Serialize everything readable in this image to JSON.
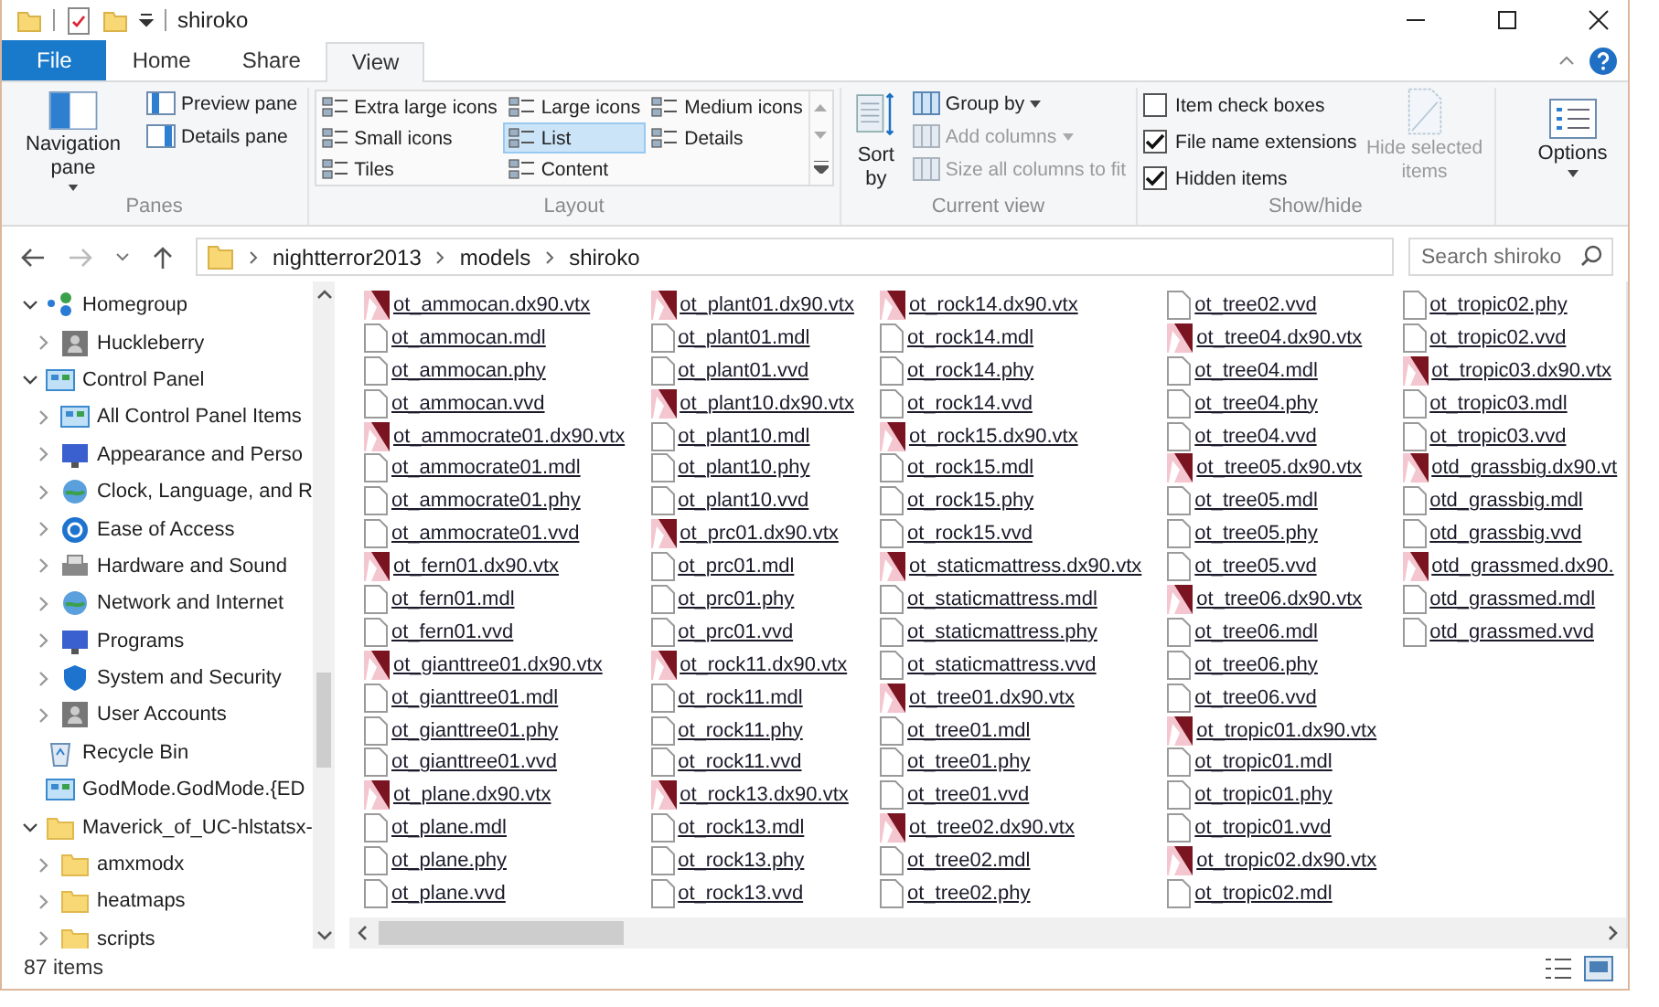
{
  "title_bar": {
    "title": "shiroko"
  },
  "ribbon": {
    "tabs": [
      {
        "label": "File",
        "kind": "file",
        "selected": false
      },
      {
        "label": "Home",
        "kind": "tab",
        "selected": false
      },
      {
        "label": "Share",
        "kind": "tab",
        "selected": false
      },
      {
        "label": "View",
        "kind": "tab",
        "selected": true
      }
    ],
    "panes": {
      "label": "Panes",
      "navigation_button": "Navigation pane",
      "buttons": [
        "Preview pane",
        "Details pane"
      ]
    },
    "layout": {
      "label": "Layout",
      "options": [
        {
          "label": "Extra large icons",
          "selected": false
        },
        {
          "label": "Large icons",
          "selected": false
        },
        {
          "label": "Medium icons",
          "selected": false
        },
        {
          "label": "Small icons",
          "selected": false
        },
        {
          "label": "List",
          "selected": true
        },
        {
          "label": "Details",
          "selected": false
        },
        {
          "label": "Tiles",
          "selected": false
        },
        {
          "label": "Content",
          "selected": false
        }
      ]
    },
    "current_view": {
      "label": "Current view",
      "sort_button": "Sort by",
      "buttons": [
        {
          "label": "Group by",
          "disabled": false,
          "dropdown": true
        },
        {
          "label": "Add columns",
          "disabled": true,
          "dropdown": true
        },
        {
          "label": "Size all columns to fit",
          "disabled": true,
          "dropdown": false
        }
      ]
    },
    "show_hide": {
      "label": "Show/hide",
      "checkboxes": [
        {
          "label": "Item check boxes",
          "checked": false
        },
        {
          "label": "File name extensions",
          "checked": true
        },
        {
          "label": "Hidden items",
          "checked": true
        }
      ],
      "hide_selected": {
        "label": "Hide selected items",
        "disabled": true
      }
    },
    "options": {
      "label": "Options"
    }
  },
  "address_bar": {
    "path": [
      "nightterror2013",
      "models",
      "shiroko"
    ],
    "search": {
      "placeholder": "Search shiroko"
    }
  },
  "navigation": [
    {
      "label": "Homegroup",
      "kind": "nodes",
      "expanded": true,
      "children": [
        {
          "label": "Huckleberry",
          "kind": "person",
          "expanded": false
        }
      ]
    },
    {
      "label": "Control Panel",
      "kind": "panel",
      "expanded": true,
      "children": [
        {
          "label": "All Control Panel Items",
          "kind": "panel",
          "expanded": false
        },
        {
          "label": "Appearance and Perso",
          "kind": "monitor",
          "expanded": false
        },
        {
          "label": "Clock, Language, and R",
          "kind": "globe",
          "expanded": false
        },
        {
          "label": "Ease of Access",
          "kind": "circle",
          "expanded": false
        },
        {
          "label": "Hardware and Sound",
          "kind": "printer",
          "expanded": false
        },
        {
          "label": "Network and Internet",
          "kind": "globe",
          "expanded": false
        },
        {
          "label": "Programs",
          "kind": "monitor",
          "expanded": false
        },
        {
          "label": "System and Security",
          "kind": "shield",
          "expanded": false
        },
        {
          "label": "User Accounts",
          "kind": "person",
          "expanded": false
        }
      ]
    },
    {
      "label": "Recycle Bin",
      "kind": "bin"
    },
    {
      "label": "GodMode.GodMode.{ED",
      "kind": "panel"
    },
    {
      "label": "Maverick_of_UC-hlstatsx-",
      "kind": "folder",
      "expanded": true,
      "children": [
        {
          "label": "amxmodx",
          "kind": "folder",
          "expanded": false
        },
        {
          "label": "heatmaps",
          "kind": "folder",
          "expanded": false
        },
        {
          "label": "scripts",
          "kind": "folder",
          "expanded": false
        }
      ]
    }
  ],
  "files": [
    {
      "name": "ot_ammocan.dx90.vtx",
      "kind": "image"
    },
    {
      "name": "ot_ammocan.mdl",
      "kind": "file"
    },
    {
      "name": "ot_ammocan.phy",
      "kind": "file"
    },
    {
      "name": "ot_ammocan.vvd",
      "kind": "file"
    },
    {
      "name": "ot_ammocrate01.dx90.vtx",
      "kind": "image"
    },
    {
      "name": "ot_ammocrate01.mdl",
      "kind": "file"
    },
    {
      "name": "ot_ammocrate01.phy",
      "kind": "file"
    },
    {
      "name": "ot_ammocrate01.vvd",
      "kind": "file"
    },
    {
      "name": "ot_fern01.dx90.vtx",
      "kind": "image"
    },
    {
      "name": "ot_fern01.mdl",
      "kind": "file"
    },
    {
      "name": "ot_fern01.vvd",
      "kind": "file"
    },
    {
      "name": "ot_gianttree01.dx90.vtx",
      "kind": "image"
    },
    {
      "name": "ot_gianttree01.mdl",
      "kind": "file"
    },
    {
      "name": "ot_gianttree01.phy",
      "kind": "file"
    },
    {
      "name": "ot_gianttree01.vvd",
      "kind": "file"
    },
    {
      "name": "ot_plane.dx90.vtx",
      "kind": "image"
    },
    {
      "name": "ot_plane.mdl",
      "kind": "file"
    },
    {
      "name": "ot_plane.phy",
      "kind": "file"
    },
    {
      "name": "ot_plane.vvd",
      "kind": "file"
    },
    {
      "name": "ot_plant01.dx90.vtx",
      "kind": "image"
    },
    {
      "name": "ot_plant01.mdl",
      "kind": "file"
    },
    {
      "name": "ot_plant01.vvd",
      "kind": "file"
    },
    {
      "name": "ot_plant10.dx90.vtx",
      "kind": "image"
    },
    {
      "name": "ot_plant10.mdl",
      "kind": "file"
    },
    {
      "name": "ot_plant10.phy",
      "kind": "file"
    },
    {
      "name": "ot_plant10.vvd",
      "kind": "file"
    },
    {
      "name": "ot_prc01.dx90.vtx",
      "kind": "image"
    },
    {
      "name": "ot_prc01.mdl",
      "kind": "file"
    },
    {
      "name": "ot_prc01.phy",
      "kind": "file"
    },
    {
      "name": "ot_prc01.vvd",
      "kind": "file"
    },
    {
      "name": "ot_rock11.dx90.vtx",
      "kind": "image"
    },
    {
      "name": "ot_rock11.mdl",
      "kind": "file"
    },
    {
      "name": "ot_rock11.phy",
      "kind": "file"
    },
    {
      "name": "ot_rock11.vvd",
      "kind": "file"
    },
    {
      "name": "ot_rock13.dx90.vtx",
      "kind": "image"
    },
    {
      "name": "ot_rock13.mdl",
      "kind": "file"
    },
    {
      "name": "ot_rock13.phy",
      "kind": "file"
    },
    {
      "name": "ot_rock13.vvd",
      "kind": "file"
    },
    {
      "name": "ot_rock14.dx90.vtx",
      "kind": "image"
    },
    {
      "name": "ot_rock14.mdl",
      "kind": "file"
    },
    {
      "name": "ot_rock14.phy",
      "kind": "file"
    },
    {
      "name": "ot_rock14.vvd",
      "kind": "file"
    },
    {
      "name": "ot_rock15.dx90.vtx",
      "kind": "image"
    },
    {
      "name": "ot_rock15.mdl",
      "kind": "file"
    },
    {
      "name": "ot_rock15.phy",
      "kind": "file"
    },
    {
      "name": "ot_rock15.vvd",
      "kind": "file"
    },
    {
      "name": "ot_staticmattress.dx90.vtx",
      "kind": "image"
    },
    {
      "name": "ot_staticmattress.mdl",
      "kind": "file"
    },
    {
      "name": "ot_staticmattress.phy",
      "kind": "file"
    },
    {
      "name": "ot_staticmattress.vvd",
      "kind": "file"
    },
    {
      "name": "ot_tree01.dx90.vtx",
      "kind": "image"
    },
    {
      "name": "ot_tree01.mdl",
      "kind": "file"
    },
    {
      "name": "ot_tree01.phy",
      "kind": "file"
    },
    {
      "name": "ot_tree01.vvd",
      "kind": "file"
    },
    {
      "name": "ot_tree02.dx90.vtx",
      "kind": "image"
    },
    {
      "name": "ot_tree02.mdl",
      "kind": "file"
    },
    {
      "name": "ot_tree02.phy",
      "kind": "file"
    },
    {
      "name": "ot_tree02.vvd",
      "kind": "file"
    },
    {
      "name": "ot_tree04.dx90.vtx",
      "kind": "image"
    },
    {
      "name": "ot_tree04.mdl",
      "kind": "file"
    },
    {
      "name": "ot_tree04.phy",
      "kind": "file"
    },
    {
      "name": "ot_tree04.vvd",
      "kind": "file"
    },
    {
      "name": "ot_tree05.dx90.vtx",
      "kind": "image"
    },
    {
      "name": "ot_tree05.mdl",
      "kind": "file"
    },
    {
      "name": "ot_tree05.phy",
      "kind": "file"
    },
    {
      "name": "ot_tree05.vvd",
      "kind": "file"
    },
    {
      "name": "ot_tree06.dx90.vtx",
      "kind": "image"
    },
    {
      "name": "ot_tree06.mdl",
      "kind": "file"
    },
    {
      "name": "ot_tree06.phy",
      "kind": "file"
    },
    {
      "name": "ot_tree06.vvd",
      "kind": "file"
    },
    {
      "name": "ot_tropic01.dx90.vtx",
      "kind": "image"
    },
    {
      "name": "ot_tropic01.mdl",
      "kind": "file"
    },
    {
      "name": "ot_tropic01.phy",
      "kind": "file"
    },
    {
      "name": "ot_tropic01.vvd",
      "kind": "file"
    },
    {
      "name": "ot_tropic02.dx90.vtx",
      "kind": "image"
    },
    {
      "name": "ot_tropic02.mdl",
      "kind": "file"
    },
    {
      "name": "ot_tropic02.phy",
      "kind": "file"
    },
    {
      "name": "ot_tropic02.vvd",
      "kind": "file"
    },
    {
      "name": "ot_tropic03.dx90.vtx",
      "kind": "image"
    },
    {
      "name": "ot_tropic03.mdl",
      "kind": "file"
    },
    {
      "name": "ot_tropic03.vvd",
      "kind": "file"
    },
    {
      "name": "otd_grassbig.dx90.vt",
      "kind": "image"
    },
    {
      "name": "otd_grassbig.mdl",
      "kind": "file"
    },
    {
      "name": "otd_grassbig.vvd",
      "kind": "file"
    },
    {
      "name": "otd_grassmed.dx90.",
      "kind": "image"
    },
    {
      "name": "otd_grassmed.mdl",
      "kind": "file"
    },
    {
      "name": "otd_grassmed.vvd",
      "kind": "file"
    }
  ],
  "status_bar": {
    "item_count": "87 items"
  }
}
